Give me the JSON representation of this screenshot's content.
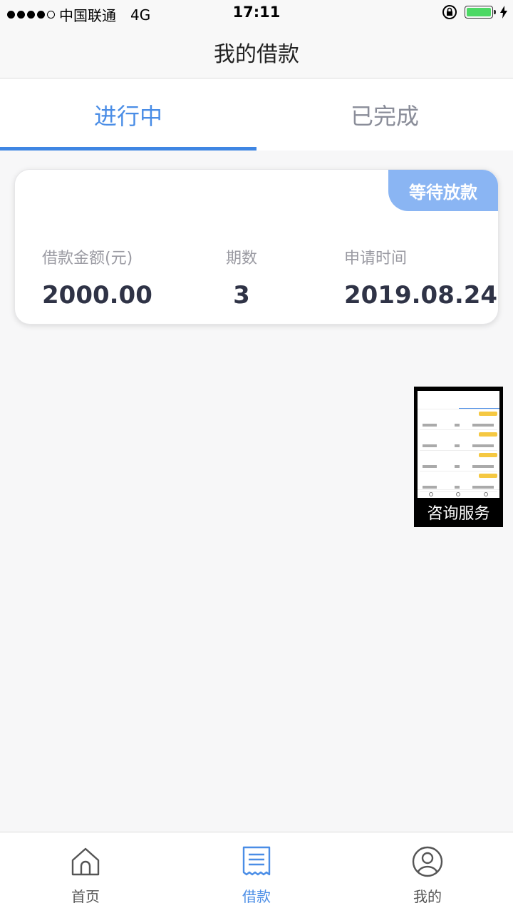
{
  "status_bar": {
    "carrier": "中国联通",
    "network": "4G",
    "time": "17:11",
    "signal_bars_filled": 4,
    "battery_level": 1.0
  },
  "header": {
    "title": "我的借款"
  },
  "tabs": [
    {
      "label": "进行中",
      "active": true
    },
    {
      "label": "已完成",
      "active": false
    }
  ],
  "loan": {
    "status": "等待放款",
    "amount_label": "借款金额(元)",
    "amount_value": "2000.00",
    "terms_label": "期数",
    "terms_value": "3",
    "date_label": "申请时间",
    "date_value": "2019.08.24"
  },
  "consult": {
    "label": "咨询服务"
  },
  "tabbar": [
    {
      "label": "首页",
      "icon": "home-icon",
      "active": false
    },
    {
      "label": "借款",
      "icon": "loan-receipt-icon",
      "active": true
    },
    {
      "label": "我的",
      "icon": "user-icon",
      "active": false
    }
  ],
  "colors": {
    "accent": "#4a8de6",
    "badge": "#8ab5f3",
    "battery": "#4cd964"
  }
}
